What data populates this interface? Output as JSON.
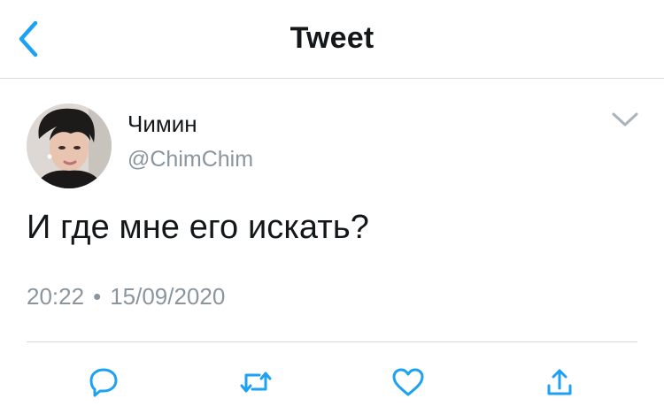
{
  "header": {
    "title": "Tweet",
    "back_icon": "chevron-left-icon"
  },
  "tweet": {
    "author_name": "Чимин",
    "author_handle": "@ChimChim",
    "text": "И где мне его искать?",
    "time": "20:22",
    "separator": "•",
    "date": "15/09/2020",
    "menu_icon": "chevron-down-icon"
  },
  "actions": [
    {
      "name": "reply",
      "icon": "reply-icon"
    },
    {
      "name": "retweet",
      "icon": "retweet-icon"
    },
    {
      "name": "like",
      "icon": "heart-icon"
    },
    {
      "name": "share",
      "icon": "share-icon"
    }
  ],
  "colors": {
    "accent": "#1da1f2",
    "text": "#14171a",
    "secondary": "#8a959e",
    "divider": "#d7dbdf"
  }
}
